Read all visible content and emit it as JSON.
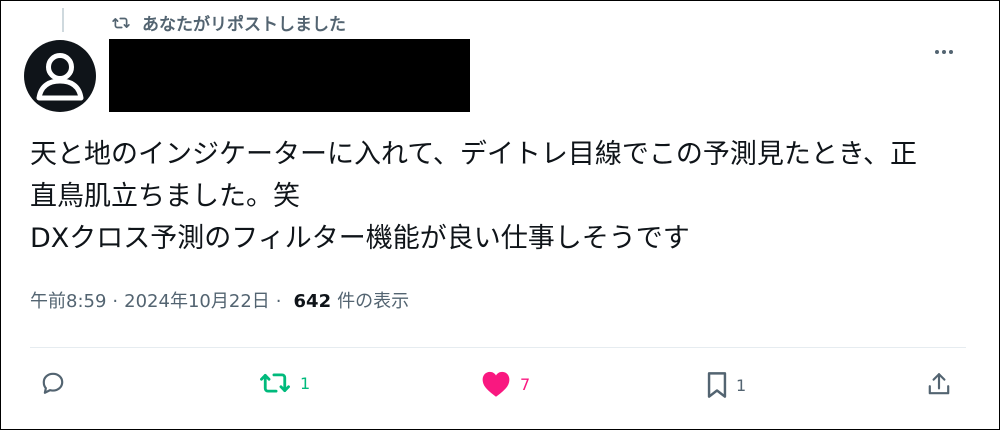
{
  "repost_context": {
    "label": "あなたがリポストしました",
    "icon": "repost-icon"
  },
  "author": {
    "avatar": "default-avatar",
    "name_redacted": true
  },
  "menu": {
    "icon": "more-icon"
  },
  "tweet": {
    "lines": [
      "天と地のインジケーターに入れて、デイトレ目線でこの予測見たとき、正",
      "直鳥肌立ちました。笑",
      "DXクロス予測のフィルター機能が良い仕事しそうです"
    ]
  },
  "meta": {
    "time": "午前8:59",
    "separator": "·",
    "date": "2024年10月22日",
    "views_count": "642",
    "views_label": "件の表示"
  },
  "actions": {
    "reply": {
      "icon": "reply-icon",
      "count": ""
    },
    "repost": {
      "icon": "repost-icon",
      "count": "1",
      "color": "#00ba7c"
    },
    "like": {
      "icon": "heart-icon",
      "count": "7",
      "color": "#f91880"
    },
    "bookmark": {
      "icon": "bookmark-icon",
      "count": "1"
    },
    "share": {
      "icon": "share-icon"
    }
  },
  "colors": {
    "muted": "#536471",
    "text": "#0f1419",
    "divider": "#e6ecf0"
  }
}
